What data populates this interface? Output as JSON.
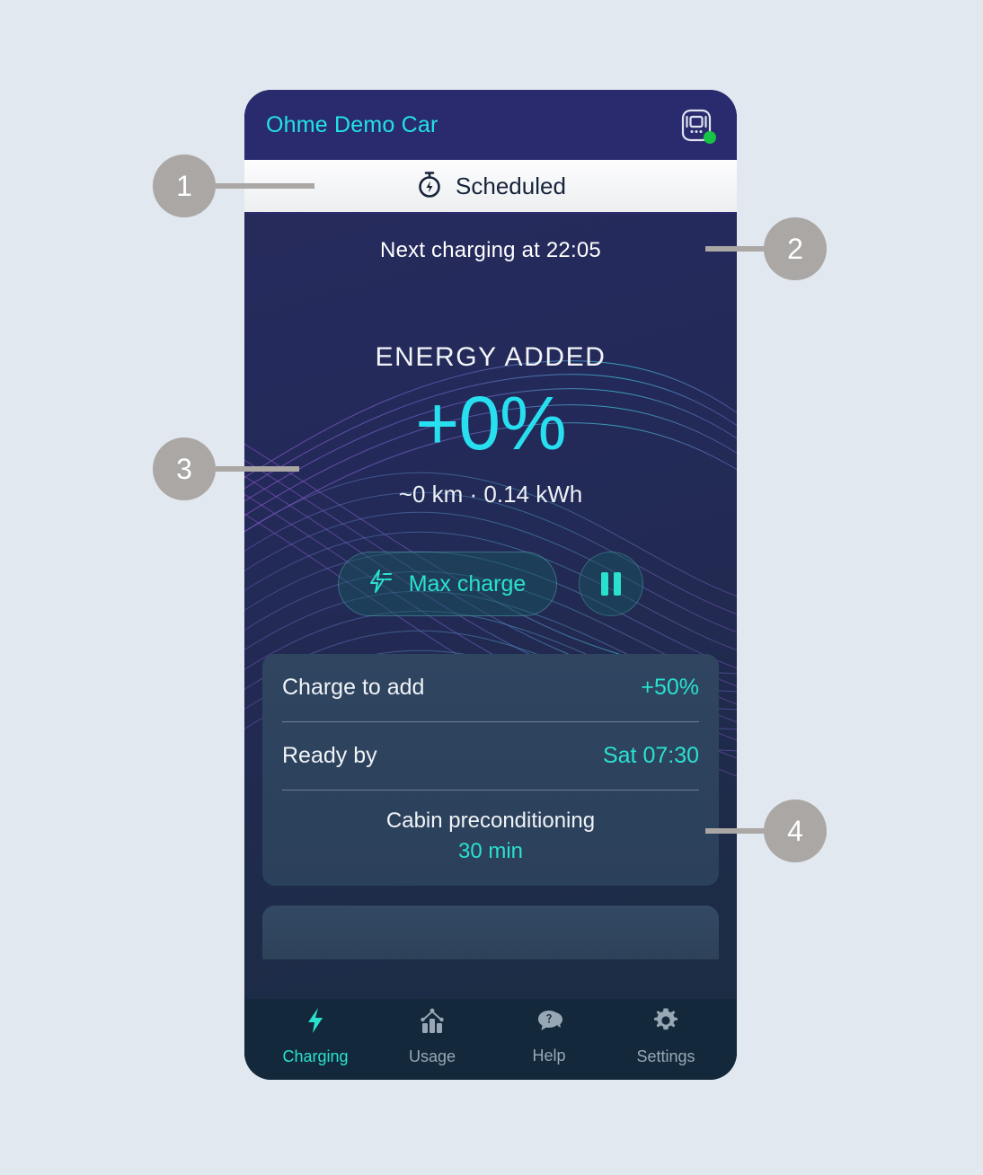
{
  "page": {
    "background_color": "#e1e8ef"
  },
  "phone": {
    "header": {
      "title": "Ohme Demo Car",
      "title_color": "#22e4e4",
      "background_color": "#2a2b6e",
      "charger_icon": "charger-station-icon",
      "status_dot_color": "#18c446"
    },
    "status_bar": {
      "icon": "stopwatch-icon",
      "label": "Scheduled",
      "text_color": "#16233a"
    },
    "main": {
      "next_charging": "Next charging at 22:05",
      "energy_label": "ENERGY ADDED",
      "energy_value": "+0%",
      "energy_value_color": "#28dff0",
      "energy_sub": "~0 km · 0.14 kWh",
      "actions": {
        "max_charge_icon": "lightning-bolt-speed-icon",
        "max_charge_label": "Max charge",
        "pause_icon": "pause-icon",
        "accent_color": "#2ae1d0"
      },
      "card": {
        "rows": [
          {
            "label": "Charge to add",
            "value": "+50%"
          },
          {
            "label": "Ready by",
            "value": "Sat 07:30"
          }
        ],
        "preconditioning_label": "Cabin preconditioning",
        "preconditioning_value": "30 min"
      }
    },
    "bottom_nav": {
      "items": [
        {
          "label": "Charging",
          "icon": "lightning-bolt-icon",
          "active": true
        },
        {
          "label": "Usage",
          "icon": "bar-chart-icon",
          "active": false
        },
        {
          "label": "Help",
          "icon": "question-chat-icon",
          "active": false
        },
        {
          "label": "Settings",
          "icon": "gear-icon",
          "active": false
        }
      ],
      "active_color": "#2ae1d0",
      "inactive_color": "#98a7b4"
    }
  },
  "callouts": [
    {
      "number": "1"
    },
    {
      "number": "2"
    },
    {
      "number": "3"
    },
    {
      "number": "4"
    }
  ]
}
